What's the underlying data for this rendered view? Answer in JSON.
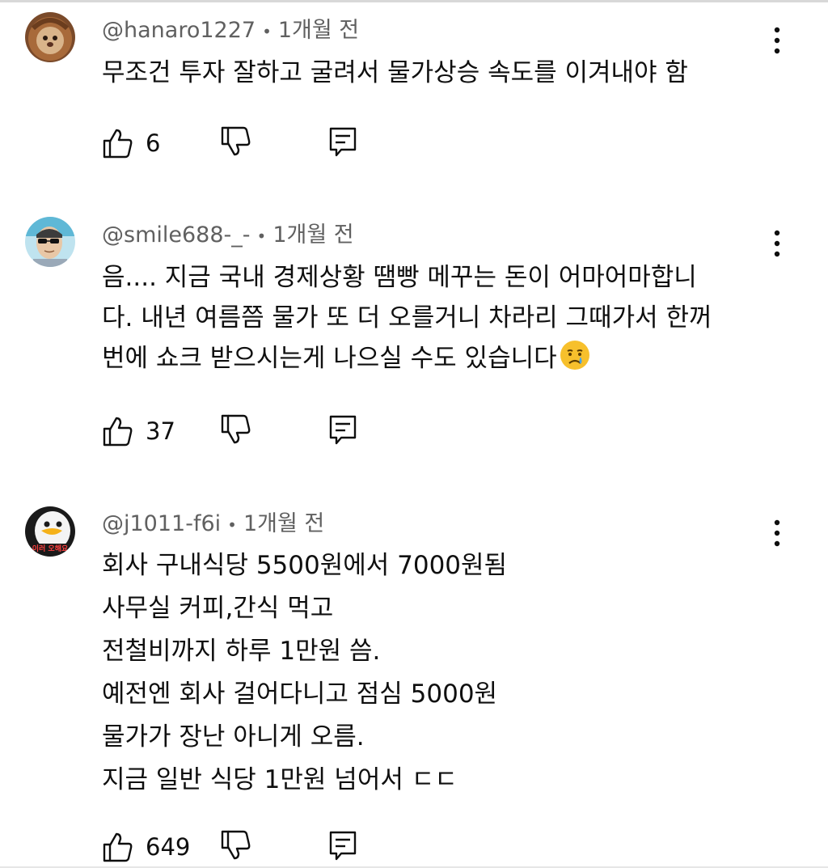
{
  "comments": [
    {
      "author": "@hanaro1227",
      "time": "1개월 전",
      "lines": [
        "무조건 투자 잘하고 굴려서 물가상승 속도를 이겨내야 함"
      ],
      "likes": "6",
      "avatar": "lion-cat-avatar"
    },
    {
      "author": "@smile688-_-",
      "time": "1개월 전",
      "lines": [
        "음.... 지금 국내 경제상황 땜빵 메꾸는 돈이 어마어마합니",
        "다. 내년 여름쯤 물가 또 더 오를거니 차라리 그때가서 한꺼",
        "번에 쇼크 받으시는게 나으실 수도 있습니다"
      ],
      "emoji": "crying-face-emoji",
      "likes": "37",
      "avatar": "sunglasses-man-avatar"
    },
    {
      "author": "@j1011-f6i",
      "time": "1개월 전",
      "lines": [
        "회사 구내식당 5500원에서 7000원됨",
        "사무실 커피,간식 먹고",
        "전철비까지 하루 1만원 씀.",
        "예전엔 회사 걸어다니고 점심 5000원",
        "물가가 장난 아니게 오름.",
        "지금 일반 식당 1만원 넘어서 ㄷㄷ"
      ],
      "likes": "649",
      "avatar": "penguin-avatar",
      "avatar_text": "이러 오해요"
    }
  ],
  "separator": "•",
  "colors": {
    "meta": "#606060",
    "text": "#0f0f0f"
  }
}
